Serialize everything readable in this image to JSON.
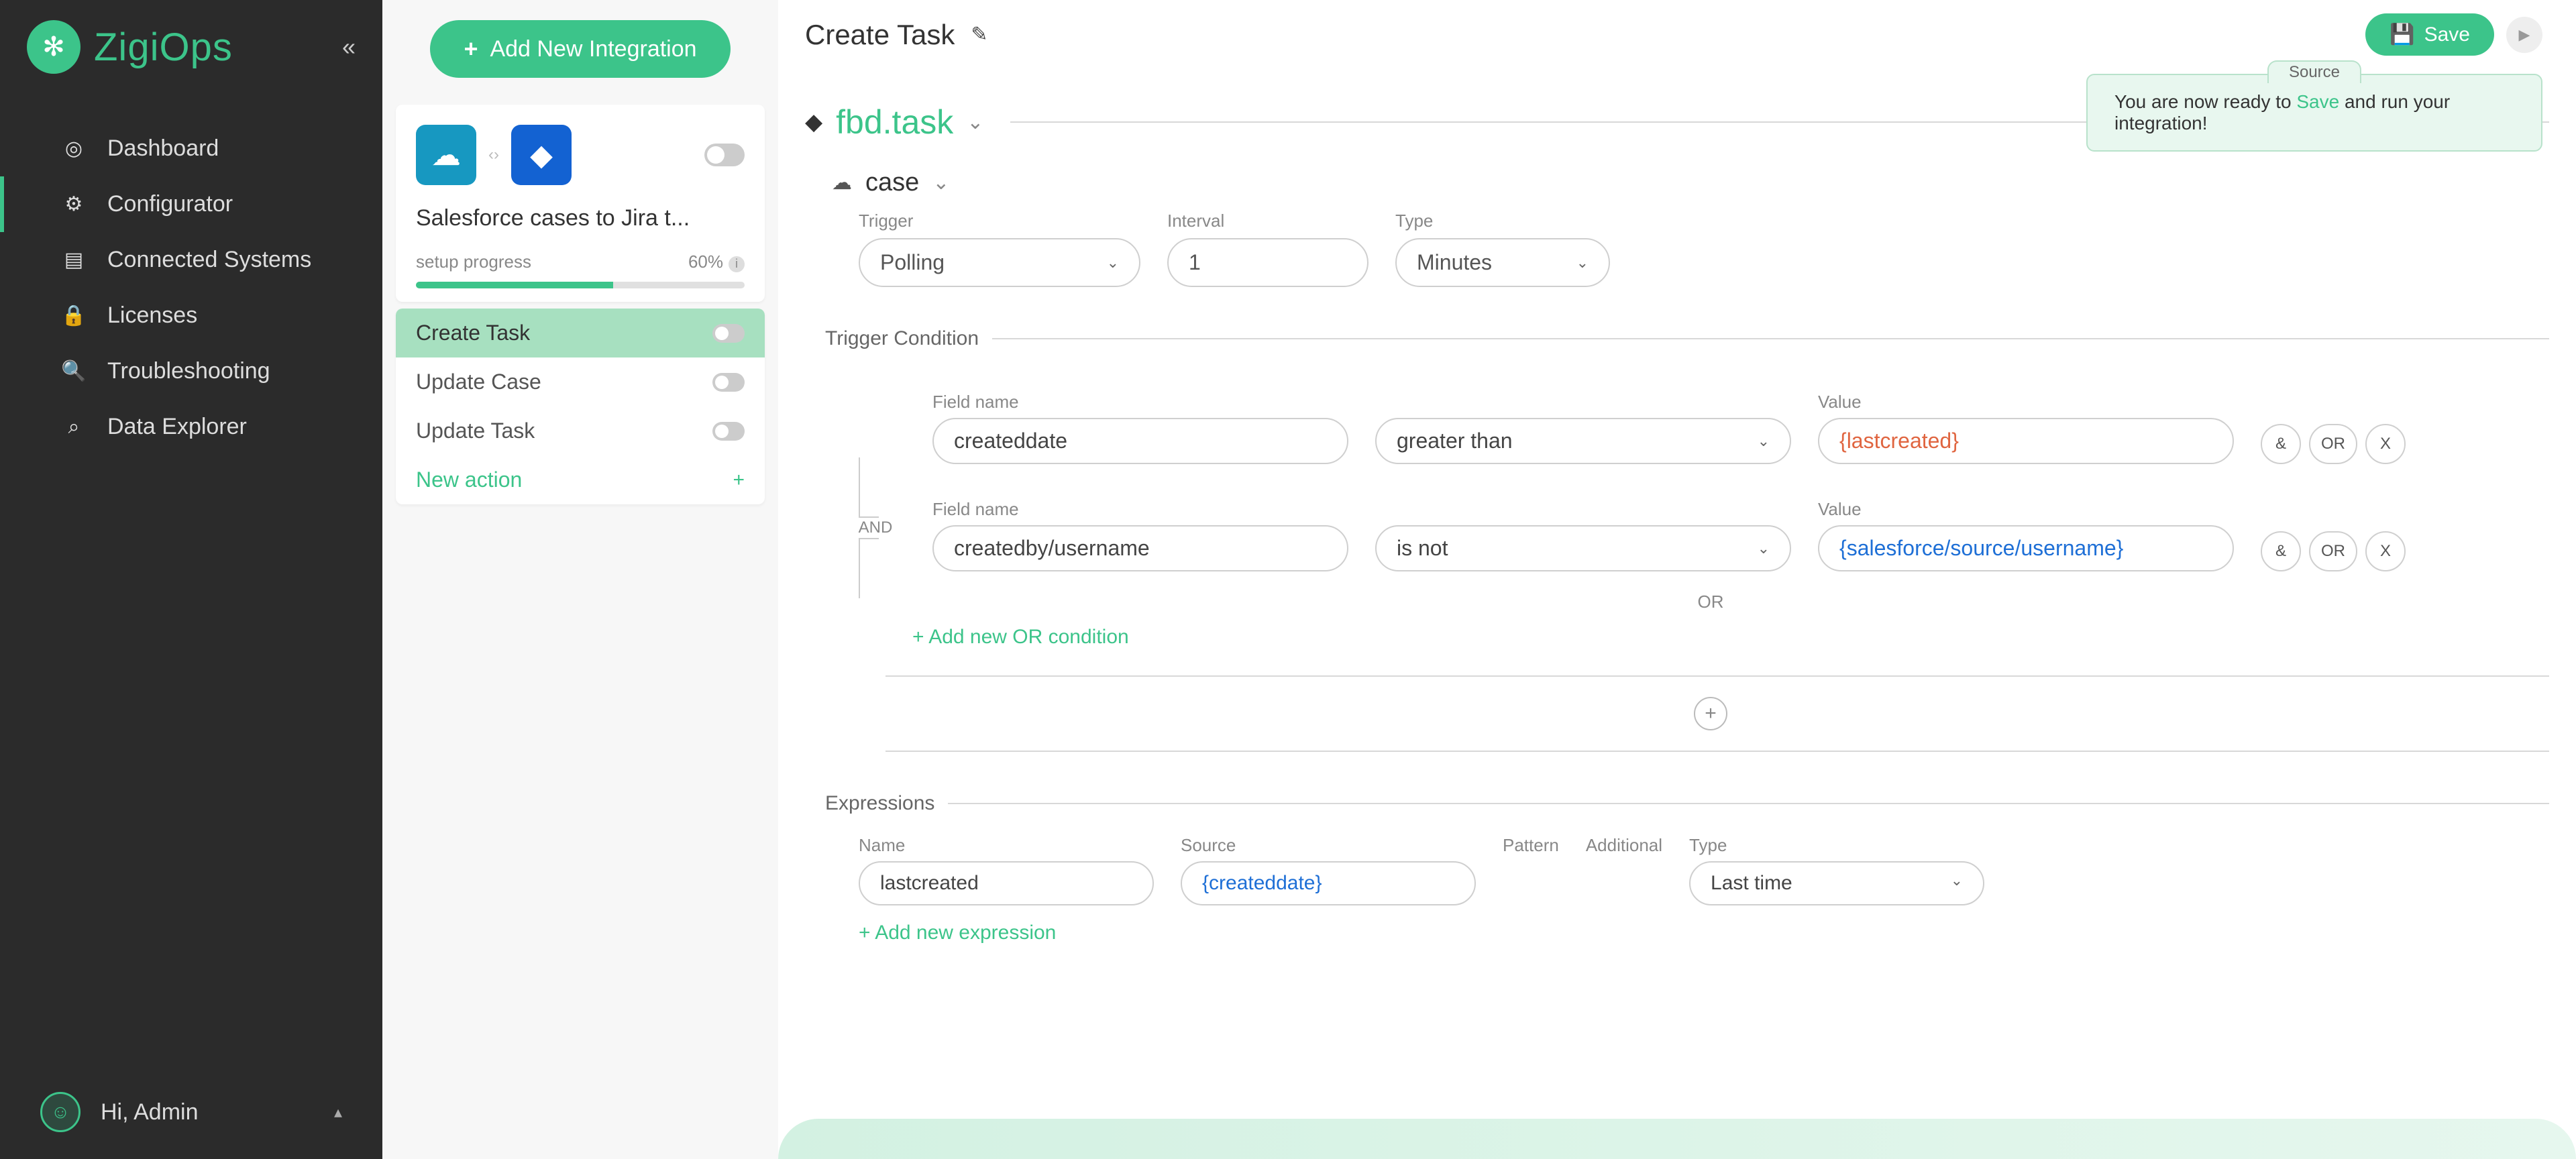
{
  "brand": "ZigiOps",
  "sidebar": {
    "items": [
      {
        "label": "Dashboard",
        "icon": "◎"
      },
      {
        "label": "Configurator",
        "icon": "⚙"
      },
      {
        "label": "Connected Systems",
        "icon": "▤"
      },
      {
        "label": "Licenses",
        "icon": "🔒"
      },
      {
        "label": "Troubleshooting",
        "icon": "🔍"
      },
      {
        "label": "Data Explorer",
        "icon": "⌕"
      }
    ],
    "user": "Hi, Admin"
  },
  "panel": {
    "add_label": "Add New Integration",
    "card_title": "Salesforce cases to Jira t...",
    "progress_label": "setup progress",
    "progress_value": "60%",
    "actions": [
      {
        "label": "Create Task",
        "active": true
      },
      {
        "label": "Update Case",
        "active": false
      },
      {
        "label": "Update Task",
        "active": false
      }
    ],
    "new_action": "New action"
  },
  "main": {
    "title": "Create Task",
    "save": "Save",
    "tooltip_tab": "Source",
    "tooltip_pre": "You are now ready to ",
    "tooltip_save": "Save",
    "tooltip_post": " and run your integration!",
    "crumb": "fbd.task",
    "case": "case",
    "trigger": {
      "label": "Trigger",
      "value": "Polling",
      "interval_label": "Interval",
      "interval_value": "1",
      "type_label": "Type",
      "type_value": "Minutes"
    },
    "trigger_condition_label": "Trigger Condition",
    "conditions": {
      "and_label": "AND",
      "rows": [
        {
          "field_label": "Field name",
          "field": "createddate",
          "op": "greater than",
          "value_label": "Value",
          "value": "{lastcreated}",
          "value_class": "val-orange"
        },
        {
          "field_label": "Field name",
          "field": "createdby/username",
          "op": "is not",
          "value_label": "Value",
          "value": "{salesforce/source/username}",
          "value_class": "val-blue"
        }
      ],
      "or_label": "OR",
      "add_or": "+ Add new OR condition",
      "amp": "&",
      "or_btn": "OR",
      "x_btn": "X"
    },
    "expressions": {
      "label": "Expressions",
      "cols": {
        "name": "Name",
        "source": "Source",
        "pattern": "Pattern",
        "additional": "Additional",
        "type": "Type"
      },
      "row": {
        "name": "lastcreated",
        "source": "{createddate}",
        "type": "Last time"
      },
      "add": "+ Add new expression"
    }
  }
}
